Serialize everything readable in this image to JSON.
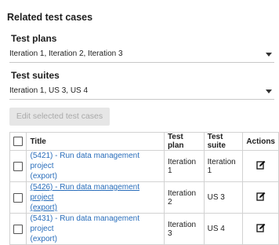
{
  "section": {
    "title": "Related test cases"
  },
  "test_plans": {
    "label": "Test plans",
    "value": "Iteration 1, Iteration 2, Iteration 3"
  },
  "test_suites": {
    "label": "Test suites",
    "value": "Iteration 1, US 3, US 4"
  },
  "edit_button": {
    "label": "Edit selected test cases"
  },
  "table": {
    "headers": {
      "title": "Title",
      "plan": "Test plan",
      "suite": "Test suite",
      "actions": "Actions"
    },
    "rows": [
      {
        "title_line1": "(5421) - Run data management project",
        "title_line2": "(export)",
        "plan": "Iteration 1",
        "suite": "Iteration 1"
      },
      {
        "title_line1": "(5426) - Run data management project",
        "title_line2": "(export)",
        "plan": "Iteration 2",
        "suite": "US 3"
      },
      {
        "title_line1": "(5431) - Run data management project",
        "title_line2": "(export)",
        "plan": "Iteration 3",
        "suite": "US 4"
      }
    ]
  }
}
